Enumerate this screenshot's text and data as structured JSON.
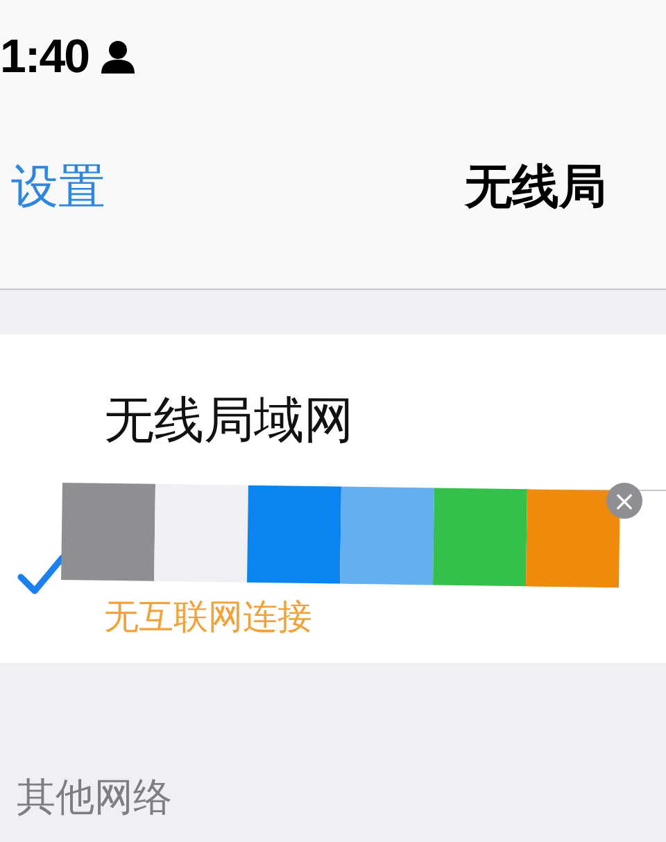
{
  "status_bar": {
    "time": "1:40"
  },
  "nav": {
    "back": "设置",
    "title": "无线局"
  },
  "wifi": {
    "label": "无线局域网"
  },
  "network": {
    "selected": true,
    "status": "无互联网连接"
  },
  "palette": {
    "swatches": [
      {
        "color": "#8e8e93"
      },
      {
        "color": "#efeff4"
      },
      {
        "color": "#0a84ef"
      },
      {
        "color": "#64aef2"
      },
      {
        "color": "#34c04a"
      },
      {
        "color": "#f08a0a"
      }
    ],
    "close": "×"
  },
  "other": {
    "header": "其他网络"
  }
}
